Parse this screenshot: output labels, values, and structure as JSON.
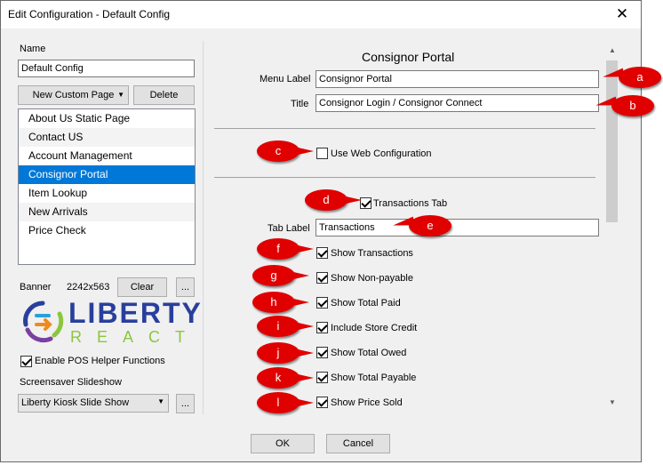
{
  "window": {
    "title": "Edit Configuration - Default Config",
    "close_glyph": "✕"
  },
  "left": {
    "name_label": "Name",
    "name_value": "Default Config",
    "new_custom_page_label": "New Custom Page",
    "dropdown_arrow": "▼",
    "delete_label": "Delete",
    "pages": [
      "About Us Static Page",
      "Contact US",
      "Account Management",
      "Consignor Portal",
      "Item Lookup",
      "New Arrivals",
      "Price Check"
    ],
    "selected_page": "Consignor Portal",
    "banner_label": "Banner",
    "banner_size": "2242x563",
    "clear_label": "Clear",
    "ellipsis": "...",
    "logo": {
      "line1": "LIBERTY",
      "line2": "REACT"
    },
    "enable_pos_label": "Enable POS Helper Functions",
    "screensaver_label": "Screensaver Slideshow",
    "screensaver_value": "Liberty Kiosk Slide Show"
  },
  "right": {
    "heading": "Consignor Portal",
    "menu_label_label": "Menu Label",
    "menu_label_value": "Consignor Portal",
    "title_label": "Title",
    "title_value": "Consignor Login / Consignor Connect",
    "use_web_config_label": "Use Web Configuration",
    "transactions_tab_label": "Transactions Tab",
    "tab_label_label": "Tab Label",
    "tab_label_value": "Transactions",
    "options": [
      "Show Transactions",
      "Show Non-payable",
      "Show Total Paid",
      "Include Store Credit",
      "Show Total Owed",
      "Show Total Payable",
      "Show Price Sold"
    ]
  },
  "footer": {
    "ok_label": "OK",
    "cancel_label": "Cancel"
  },
  "callouts": [
    "a",
    "b",
    "c",
    "d",
    "e",
    "f",
    "g",
    "h",
    "i",
    "j",
    "k",
    "l"
  ],
  "scroll": {
    "up": "▲",
    "down": "▼"
  },
  "colors": {
    "selection": "#0078d7",
    "callout": "#e00000",
    "logo_blue": "#2a3f9c",
    "logo_green": "#8cc63e"
  }
}
